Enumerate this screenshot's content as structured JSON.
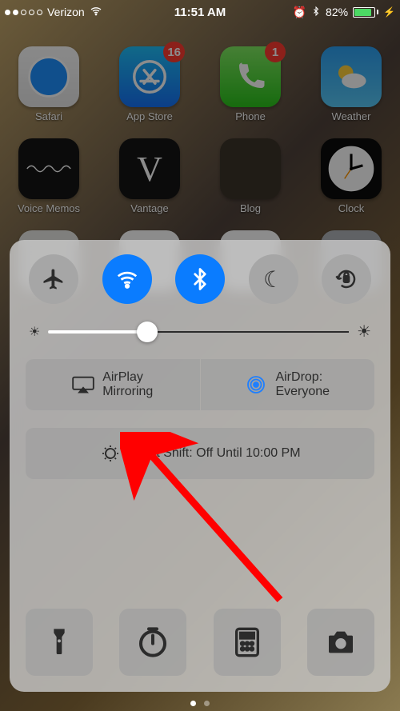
{
  "status": {
    "carrier": "Verizon",
    "time": "11:51 AM",
    "battery_pct": "82%"
  },
  "home": {
    "row1": [
      {
        "label": "Safari",
        "badge": null
      },
      {
        "label": "App Store",
        "badge": "16"
      },
      {
        "label": "Phone",
        "badge": "1"
      },
      {
        "label": "Weather",
        "badge": null
      }
    ],
    "row2": [
      {
        "label": "Voice Memos"
      },
      {
        "label": "Vantage"
      },
      {
        "label": "Blog"
      },
      {
        "label": "Clock"
      }
    ]
  },
  "control_center": {
    "toggles": {
      "airplane": "airplane-mode",
      "wifi": "wifi",
      "bluetooth": "bluetooth",
      "dnd": "do-not-disturb",
      "lock": "orientation-lock"
    },
    "airplay": {
      "line1": "AirPlay",
      "line2": "Mirroring"
    },
    "airdrop": {
      "line1": "AirDrop:",
      "line2": "Everyone"
    },
    "night_shift": "Night Shift: Off Until 10:00 PM",
    "brightness_pct": 33
  }
}
